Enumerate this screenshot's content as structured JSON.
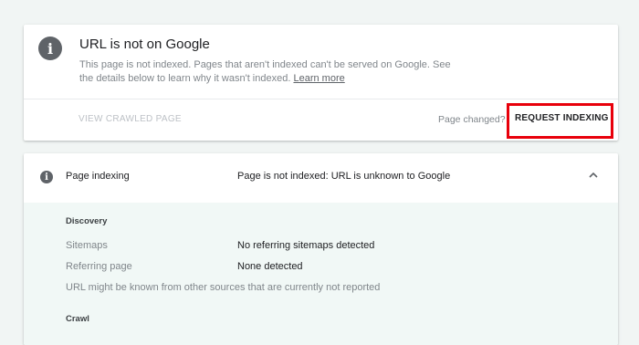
{
  "status_card": {
    "info_icon": "info-icon",
    "title": "URL is not on Google",
    "description": "This page is not indexed. Pages that aren't indexed can't be served on Google. See the details below to learn why it wasn't indexed.",
    "learn_more": "Learn more",
    "view_crawled": "VIEW CRAWLED PAGE",
    "page_changed": "Page changed?",
    "request_indexing": "REQUEST INDEXING",
    "highlight_color": "#e8000b"
  },
  "indexing_card": {
    "info_icon": "info-icon",
    "section_name": "Page indexing",
    "section_status": "Page is not indexed: URL is unknown to Google",
    "chevron_icon": "chevron-up-icon",
    "discovery": {
      "heading": "Discovery",
      "rows": [
        {
          "label": "Sitemaps",
          "value": "No referring sitemaps detected"
        },
        {
          "label": "Referring page",
          "value": "None detected"
        }
      ],
      "note": "URL might be known from other sources that are currently not reported"
    },
    "crawl": {
      "heading": "Crawl"
    }
  }
}
